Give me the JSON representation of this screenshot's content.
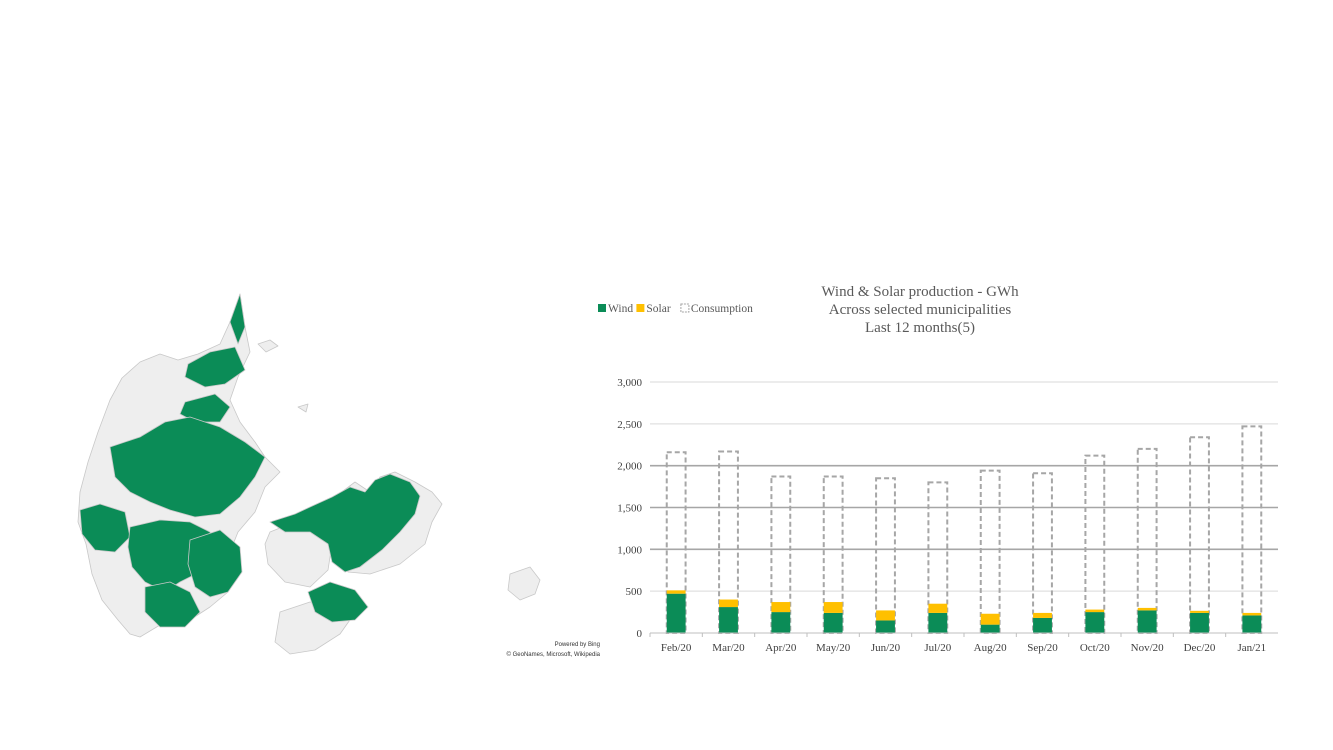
{
  "map": {
    "powered_by": "Powered by Bing",
    "attribution": "© GeoNames, Microsoft, Wikipedia",
    "selected_color": "#0b8c57",
    "unselected_color": "#eeeeee"
  },
  "chart_data": {
    "type": "bar",
    "stacked": true,
    "title": [
      "Wind & Solar production - GWh",
      "Across selected municipalities",
      "Last 12 months(5)"
    ],
    "xlabel": "",
    "ylabel": "",
    "categories": [
      "Feb/20",
      "Mar/20",
      "Apr/20",
      "May/20",
      "Jun/20",
      "Jul/20",
      "Aug/20",
      "Sep/20",
      "Oct/20",
      "Nov/20",
      "Dec/20",
      "Jan/21"
    ],
    "series": [
      {
        "name": "Wind",
        "color": "#0b8c57",
        "values": [
          470,
          310,
          250,
          240,
          150,
          240,
          100,
          180,
          250,
          270,
          240,
          210
        ]
      },
      {
        "name": "Solar",
        "color": "#ffc000",
        "values": [
          40,
          90,
          120,
          130,
          120,
          110,
          130,
          60,
          30,
          30,
          25,
          30
        ]
      },
      {
        "name": "Consumption",
        "color": "#a6a6a6",
        "style": "dashed-outline",
        "values": [
          2160,
          2170,
          1870,
          1870,
          1850,
          1800,
          1940,
          1910,
          2120,
          2200,
          2340,
          2470
        ]
      }
    ],
    "yticks": [
      "0",
      "500",
      "1,000",
      "1,500",
      "2,000",
      "2,500",
      "3,000"
    ],
    "ylim": [
      0,
      3000
    ],
    "grid": true,
    "legend_position": "top-left"
  }
}
